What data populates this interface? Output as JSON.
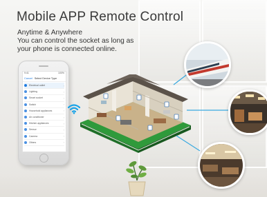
{
  "banner": {
    "title": "Mobile APP Remote Control",
    "subtitle_lines": [
      "Anytime & Anywhere",
      "You can control the socket as long as",
      "your phone is connected online."
    ]
  },
  "phone_app": {
    "status_left": "9:41",
    "status_right": "100%",
    "header_left": "Cancel",
    "header_title": "Select Device Type",
    "items": [
      "Electrical outlet",
      "Lighting",
      "Smart socket",
      "Switch",
      "Household appliances",
      "Air conditioner",
      "Kitchen appliances",
      "Sensor",
      "Camera",
      "Others"
    ],
    "selected_index": 0
  },
  "colors": {
    "accent_blue": "#1e7be0",
    "wifi_blue": "#1aa3e8",
    "callout_line": "#39a9e0",
    "title_text": "#3a3a3a"
  },
  "icons": {
    "wifi": "wifi-icon",
    "house": "smart-house-illustration",
    "train": "train-photo",
    "office": "office-photo",
    "restaurant": "restaurant-photo",
    "plant": "potted-plant-icon"
  }
}
